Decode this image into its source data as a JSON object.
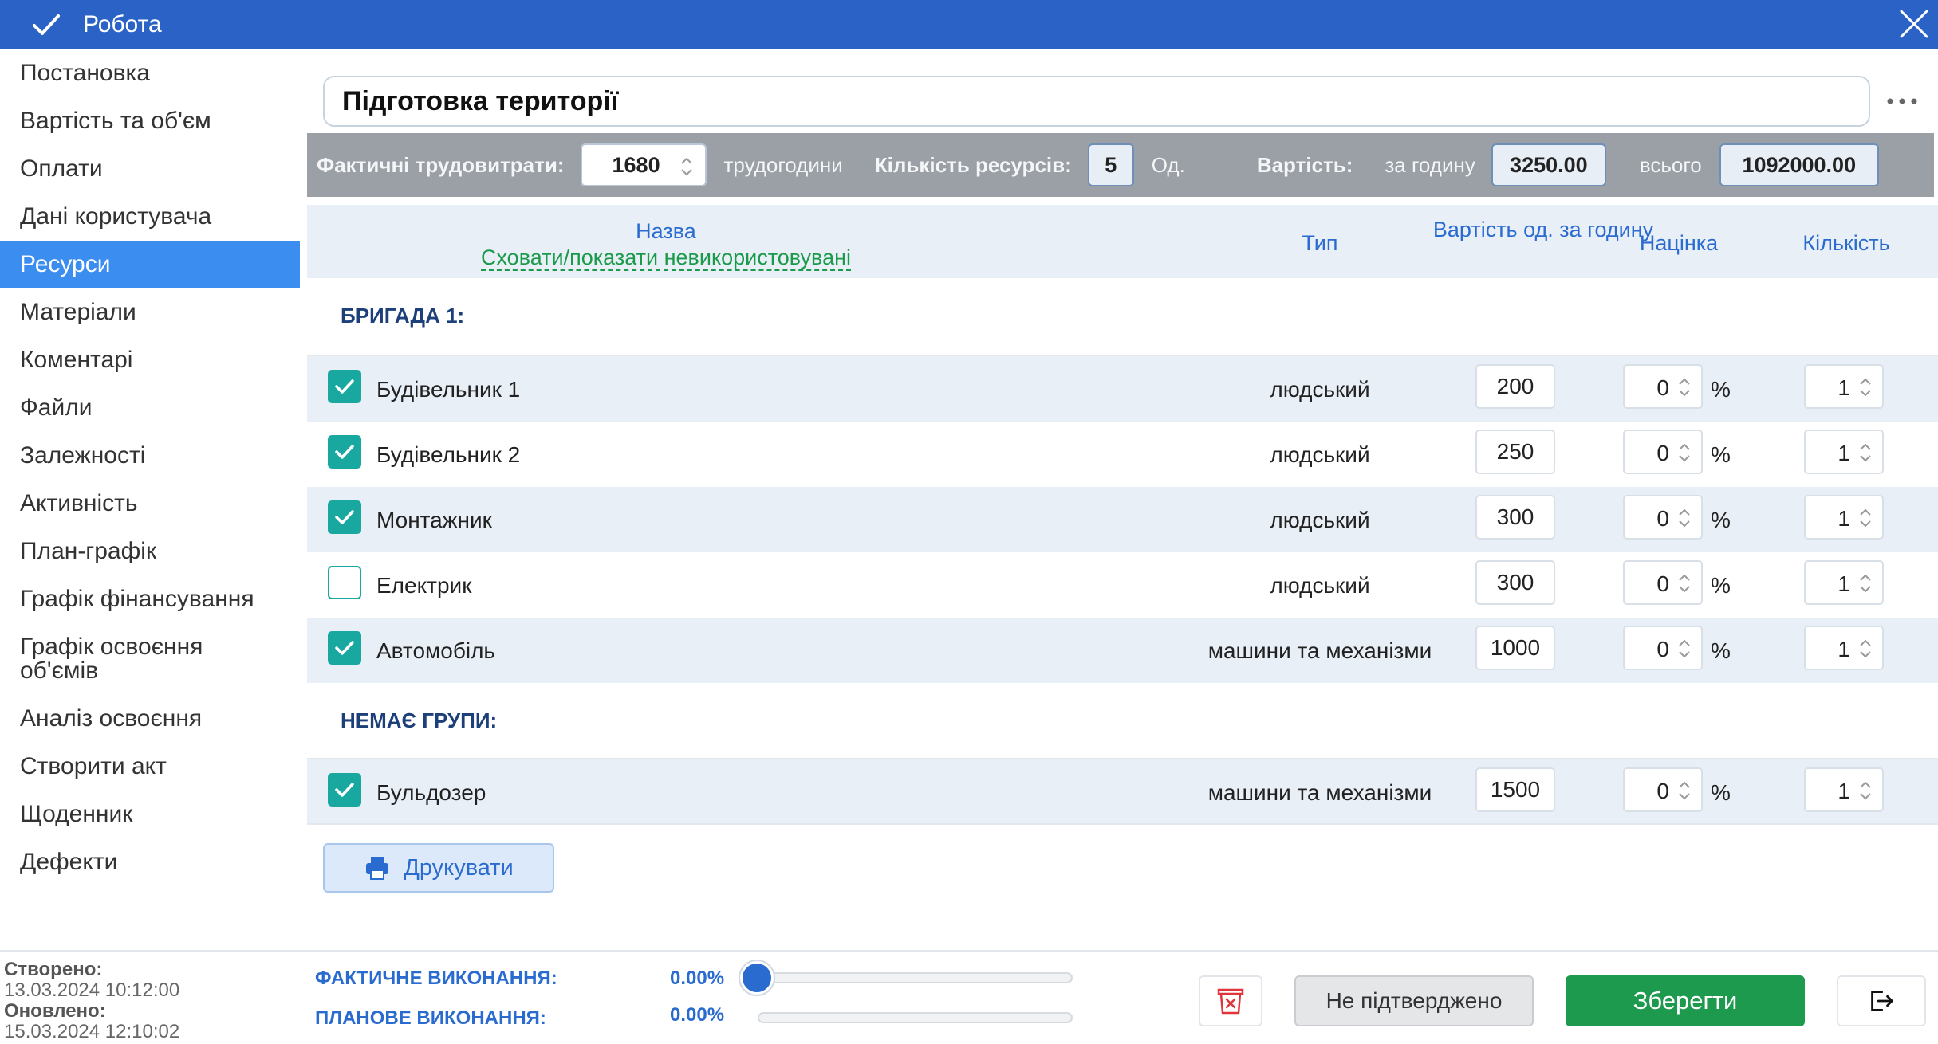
{
  "window": {
    "title": "Робота"
  },
  "sidebar": {
    "items": [
      {
        "label": "Постановка"
      },
      {
        "label": "Вартість та об'єм"
      },
      {
        "label": "Оплати"
      },
      {
        "label": "Дані користувача"
      },
      {
        "label": "Ресурси",
        "active": true
      },
      {
        "label": "Матеріали"
      },
      {
        "label": "Коментарі"
      },
      {
        "label": "Файли"
      },
      {
        "label": "Залежності"
      },
      {
        "label": "Активність"
      },
      {
        "label": "План-графік"
      },
      {
        "label": "Графік фінансування"
      },
      {
        "label": "Графік освоєння об'ємів"
      },
      {
        "label": "Аналіз освоєння"
      },
      {
        "label": "Створити акт"
      },
      {
        "label": "Щоденник"
      },
      {
        "label": "Дефекти"
      }
    ]
  },
  "task": {
    "name": "Підготовка території"
  },
  "summary": {
    "labor_label": "Фактичні трудовитрати:",
    "labor_value": "1680",
    "labor_unit": "трудогодини",
    "resources_label": "Кількість ресурсів:",
    "resources_value": "5",
    "resources_unit": "Од.",
    "cost_label": "Вартість:",
    "per_hour_label": "за годину",
    "per_hour_value": "3250.00",
    "total_label": "всього",
    "total_value": "1092000.00"
  },
  "table": {
    "headers": {
      "name": "Назва",
      "toggle": "Сховати/показати невикористовувані",
      "type": "Тип",
      "cost": "Вартість од. за годину",
      "markup": "Націнка",
      "qty": "Кількість"
    },
    "groups": [
      {
        "title": "БРИГАДА 1:",
        "rows": [
          {
            "checked": true,
            "name": "Будівельник 1",
            "type": "людський",
            "cost": "200",
            "markup": "0",
            "pct": "%",
            "qty": "1"
          },
          {
            "checked": true,
            "name": "Будівельник 2",
            "type": "людський",
            "cost": "250",
            "markup": "0",
            "pct": "%",
            "qty": "1"
          },
          {
            "checked": true,
            "name": "Монтажник",
            "type": "людський",
            "cost": "300",
            "markup": "0",
            "pct": "%",
            "qty": "1"
          },
          {
            "checked": false,
            "name": "Електрик",
            "type": "людський",
            "cost": "300",
            "markup": "0",
            "pct": "%",
            "qty": "1"
          },
          {
            "checked": true,
            "name": "Автомобіль",
            "type": "машини та механізми",
            "cost": "1000",
            "markup": "0",
            "pct": "%",
            "qty": "1"
          }
        ]
      },
      {
        "title": "НЕМАЄ ГРУПИ:",
        "rows": [
          {
            "checked": true,
            "name": "Бульдозер",
            "type": "машини та механізми",
            "cost": "1500",
            "markup": "0",
            "pct": "%",
            "qty": "1"
          }
        ]
      }
    ]
  },
  "print_label": "Друкувати",
  "footer": {
    "created_label": "Створено:",
    "created_value": "13.03.2024 10:12:00",
    "updated_label": "Оновлено:",
    "updated_value": "15.03.2024 12:10:02",
    "actual_label": "ФАКТИЧНЕ ВИКОНАННЯ:",
    "actual_value": "0.00%",
    "actual_fraction": 0,
    "planned_label": "ПЛАНОВЕ ВИКОНАННЯ:",
    "planned_value": "0.00%",
    "planned_fraction": 0,
    "status_label": "Не підтверджено",
    "save_label": "Зберегти"
  },
  "colors": {
    "titlebar": "#2a63c5",
    "accent": "#3b8ef0",
    "checkbox": "#19a8a0",
    "save": "#1e9a4e",
    "link_green": "#1a9a4a"
  }
}
